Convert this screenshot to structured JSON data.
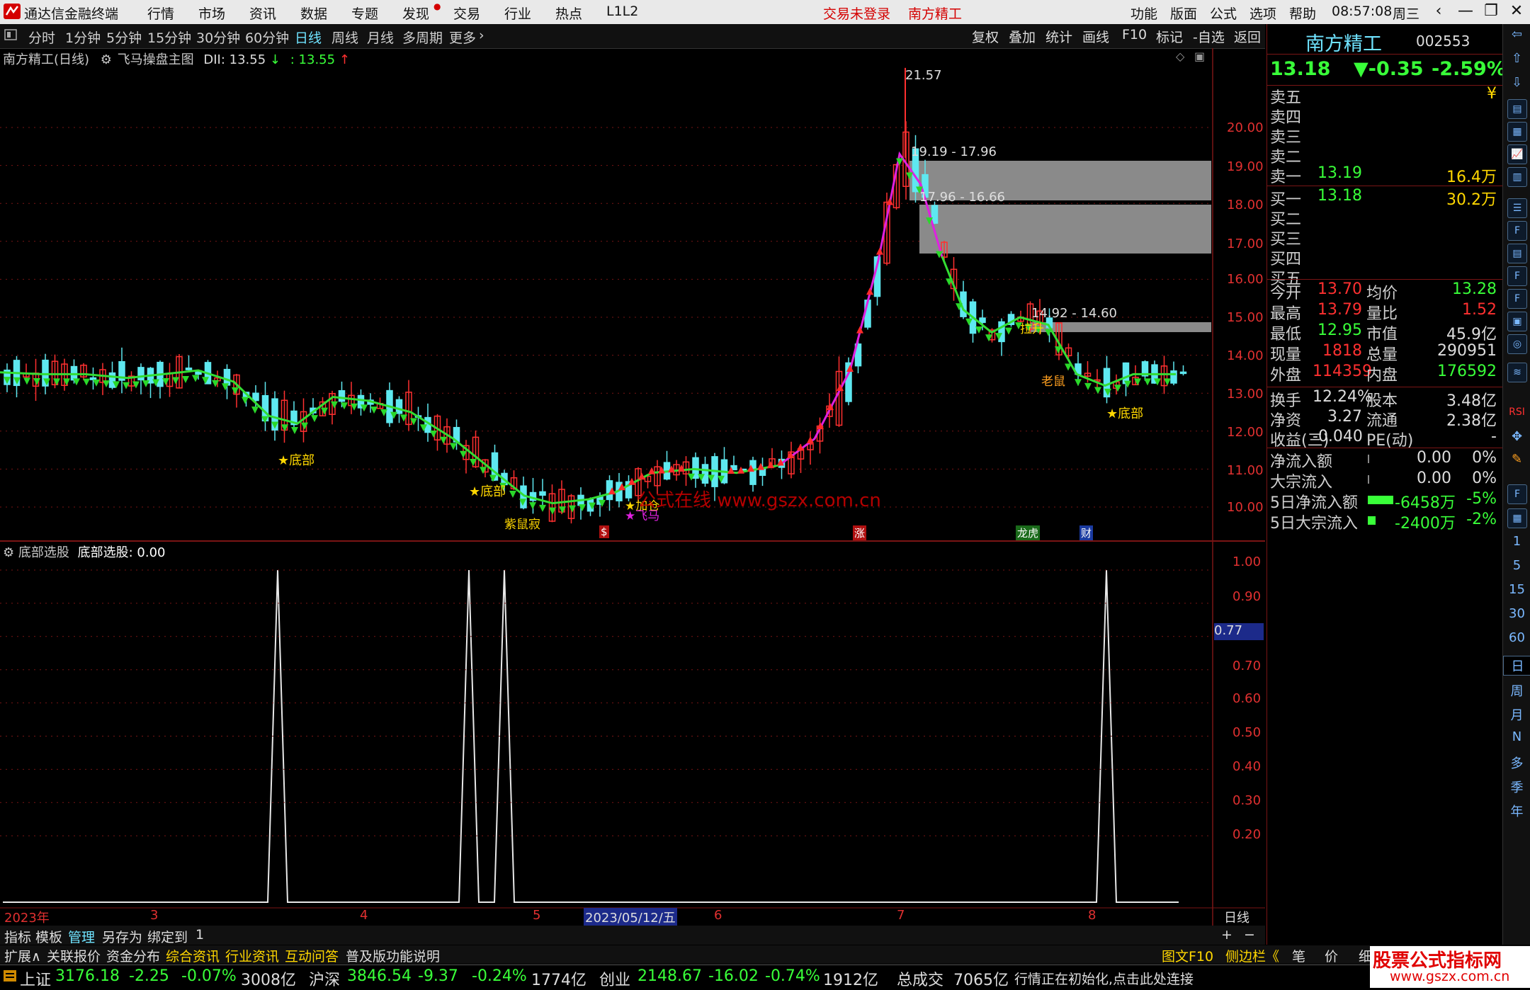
{
  "titlebar": {
    "app_name": "通达信金融终端",
    "menus": [
      "行情",
      "市场",
      "资讯",
      "数据",
      "专题",
      "发现",
      "交易",
      "行业",
      "热点",
      "L1L2"
    ],
    "status_login": "交易未登录",
    "stock_name": "南方精工",
    "right_menus": [
      "功能",
      "版面",
      "公式",
      "选项",
      "帮助"
    ],
    "time": "08:57:08",
    "weekday": "周三"
  },
  "toolbar": {
    "periods": [
      "分时",
      "1分钟",
      "5分钟",
      "15分钟",
      "30分钟",
      "60分钟",
      "日线",
      "周线",
      "月线",
      "多周期",
      "更多"
    ],
    "active_period": "日线",
    "right_buttons": [
      "复权",
      "叠加",
      "统计",
      "画线",
      "F10",
      "标记",
      "-自选",
      "返回"
    ]
  },
  "main_chart": {
    "header_title": "南方精工(日线)",
    "indicator_name": "飞马操盘主图",
    "indicator_value_label": "DII: 13.55",
    "indicator_value2": ": 13.55",
    "y_axis": [
      "20.00",
      "19.00",
      "18.00",
      "17.00",
      "16.00",
      "15.00",
      "14.00",
      "13.00",
      "12.00",
      "11.00",
      "10.00"
    ],
    "peak_label": "21.57",
    "zone1_label": "19.19 - 17.96",
    "zone2_label": "17.96 - 16.66",
    "zone3_label": "14.92 - 14.60",
    "signals": [
      "底部",
      "底部",
      "底部",
      "紫鼠寂",
      "加仓",
      "飞马",
      "老鼠",
      "拉升"
    ],
    "watermark": "公式在线    www.gszx.com.cn",
    "markers": [
      "$",
      "涨",
      "龙虎",
      "财"
    ]
  },
  "sub_chart": {
    "title": "底部选股",
    "value_label": "底部选股: 0.00",
    "y_axis": [
      "1.00",
      "0.90",
      "0.70",
      "0.60",
      "0.50",
      "0.40",
      "0.30",
      "0.20"
    ],
    "current_value": "0.77"
  },
  "x_axis": {
    "labels": [
      "2023年",
      "3",
      "4",
      "5",
      "2023/05/12/五",
      "6",
      "7",
      "8"
    ],
    "period_label": "日线"
  },
  "quote_panel": {
    "name": "南方精工",
    "code": "002553",
    "price": "13.18",
    "change": "▼-0.35",
    "change_pct": "-2.59%",
    "asks": [
      {
        "label": "卖五",
        "price": "",
        "vol": "¥"
      },
      {
        "label": "卖四",
        "price": "",
        "vol": ""
      },
      {
        "label": "卖三",
        "price": "",
        "vol": ""
      },
      {
        "label": "卖二",
        "price": "",
        "vol": ""
      },
      {
        "label": "卖一",
        "price": "13.19",
        "vol": "16.4万"
      }
    ],
    "bids": [
      {
        "label": "买一",
        "price": "13.18",
        "vol": "30.2万"
      },
      {
        "label": "买二",
        "price": "",
        "vol": ""
      },
      {
        "label": "买三",
        "price": "",
        "vol": ""
      },
      {
        "label": "买四",
        "price": "",
        "vol": ""
      },
      {
        "label": "买五",
        "price": "",
        "vol": ""
      }
    ],
    "stats": [
      {
        "l1": "今开",
        "v1": "13.70",
        "c1": "#ff3030",
        "l2": "均价",
        "v2": "13.28",
        "c2": "#39ff39"
      },
      {
        "l1": "最高",
        "v1": "13.79",
        "c1": "#ff3030",
        "l2": "量比",
        "v2": "1.52",
        "c2": "#ff3030"
      },
      {
        "l1": "最低",
        "v1": "12.95",
        "c1": "#39ff39",
        "l2": "市值",
        "v2": "45.9亿",
        "c2": "#dddddd"
      },
      {
        "l1": "现量",
        "v1": "1818",
        "c1": "#ff3030",
        "l2": "总量",
        "v2": "290951",
        "c2": "#dddddd"
      },
      {
        "l1": "外盘",
        "v1": "114359",
        "c1": "#ff3030",
        "l2": "内盘",
        "v2": "176592",
        "c2": "#39ff39"
      }
    ],
    "stats2": [
      {
        "l1": "换手",
        "v1": "12.24%",
        "c1": "#dddddd",
        "l2": "股本",
        "v2": "3.48亿",
        "c2": "#dddddd"
      },
      {
        "l1": "净资",
        "v1": "3.27",
        "c1": "#dddddd",
        "l2": "流通",
        "v2": "2.38亿",
        "c2": "#dddddd"
      },
      {
        "l1": "收益(三)",
        "v1": "-0.040",
        "c1": "#dddddd",
        "l2": "PE(动)",
        "v2": "-",
        "c2": "#dddddd"
      }
    ],
    "flows": [
      {
        "label": "净流入额",
        "value": "0.00",
        "pct": "0%",
        "color": "#dddddd",
        "bar": 0
      },
      {
        "label": "大宗流入",
        "value": "0.00",
        "pct": "0%",
        "color": "#dddddd",
        "bar": 0
      },
      {
        "label": "5日净流入额",
        "value": "-6458万",
        "pct": "-5%",
        "color": "#39ff39",
        "bar": 1
      },
      {
        "label": "5日大宗流入",
        "value": "-2400万",
        "pct": "-2%",
        "color": "#39ff39",
        "bar": 0.3
      }
    ]
  },
  "icon_column": {
    "labels": [
      "1",
      "5",
      "15",
      "30",
      "60",
      "日",
      "周",
      "月",
      "N",
      "多",
      "季",
      "年"
    ]
  },
  "indicator_tabs": [
    "指标",
    "模板",
    "管理",
    "另存为",
    "绑定到",
    "1"
  ],
  "bottom_tabs": [
    "扩展∧",
    "关联报价",
    "资金分布",
    "综合资讯",
    "行业资讯",
    "互动问答",
    "普及版功能说明"
  ],
  "bottom_right_tabs": [
    "图文F10",
    "侧边栏《",
    "笔",
    "价",
    "细",
    "势"
  ],
  "ticker": {
    "sh_label": "上证",
    "sh_value": "3176.18",
    "sh_change": "-2.25",
    "sh_pct": "-0.07%",
    "sh_amount": "3008亿",
    "hs_label": "沪深",
    "hs_value": "3846.54",
    "hs_change": "-9.37",
    "hs_pct": "-0.24%",
    "hs_amount": "1774亿",
    "cy_label": "创业",
    "cy_value": "2148.67",
    "cy_change": "-16.02",
    "cy_pct": "-0.74%",
    "cy_amount": "1912亿",
    "total_label": "总成交",
    "total_value": "7065亿",
    "status": "行情正在初始化,点击此处连接",
    "brand": "股票公式指标网",
    "brand_url": "www.gszx.com.cn"
  },
  "colors": {
    "up": "#ff3030",
    "down": "#39ff39",
    "cyan": "#6fe3ff",
    "accent_red": "#d40000",
    "grid_red": "#7a1515"
  }
}
